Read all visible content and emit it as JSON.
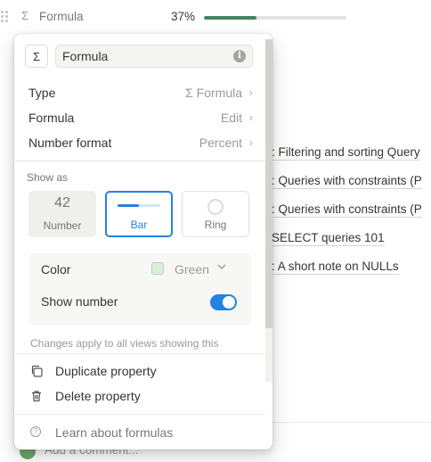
{
  "background": {
    "property_row": {
      "icon": "sigma-icon",
      "label": "Formula",
      "value_text": "37%",
      "progress": 0.37
    },
    "related_links": [
      ": Filtering and sorting Query",
      ": Queries with constraints (P",
      ": Queries with constraints (P",
      " SELECT queries 101",
      ": A short note on NULLs"
    ],
    "comment_placeholder": "Add a comment..."
  },
  "popup": {
    "type_icon": "Σ",
    "name_value": "Formula",
    "menu": {
      "type_label": "Type",
      "type_value": "Σ Formula",
      "formula_label": "Formula",
      "formula_value": "Edit",
      "number_format_label": "Number format",
      "number_format_value": "Percent"
    },
    "show_as": {
      "title": "Show as",
      "options": [
        {
          "glyph": "42",
          "label": "Number",
          "selected": false
        },
        {
          "label": "Bar",
          "selected": true
        },
        {
          "label": "Ring",
          "selected": false
        }
      ]
    },
    "settings": {
      "color_label": "Color",
      "color_value": "Green",
      "color_swatch": "#dbeddb",
      "show_number_label": "Show number",
      "show_number_on": true
    },
    "note": "Changes apply to all views showing this",
    "actions": {
      "duplicate": "Duplicate property",
      "delete": "Delete property"
    },
    "help": "Learn about formulas"
  },
  "colors": {
    "accent": "#2383e2",
    "progress": "#448361"
  }
}
